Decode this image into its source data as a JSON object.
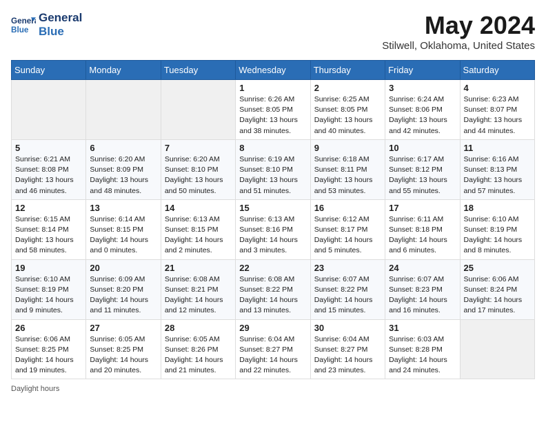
{
  "header": {
    "logo_line1": "General",
    "logo_line2": "Blue",
    "month_year": "May 2024",
    "location": "Stilwell, Oklahoma, United States"
  },
  "days_of_week": [
    "Sunday",
    "Monday",
    "Tuesday",
    "Wednesday",
    "Thursday",
    "Friday",
    "Saturday"
  ],
  "weeks": [
    [
      {
        "day": "",
        "sunrise": "",
        "sunset": "",
        "daylight": ""
      },
      {
        "day": "",
        "sunrise": "",
        "sunset": "",
        "daylight": ""
      },
      {
        "day": "",
        "sunrise": "",
        "sunset": "",
        "daylight": ""
      },
      {
        "day": "1",
        "sunrise": "6:26 AM",
        "sunset": "8:05 PM",
        "daylight": "13 hours and 38 minutes."
      },
      {
        "day": "2",
        "sunrise": "6:25 AM",
        "sunset": "8:05 PM",
        "daylight": "13 hours and 40 minutes."
      },
      {
        "day": "3",
        "sunrise": "6:24 AM",
        "sunset": "8:06 PM",
        "daylight": "13 hours and 42 minutes."
      },
      {
        "day": "4",
        "sunrise": "6:23 AM",
        "sunset": "8:07 PM",
        "daylight": "13 hours and 44 minutes."
      }
    ],
    [
      {
        "day": "5",
        "sunrise": "6:21 AM",
        "sunset": "8:08 PM",
        "daylight": "13 hours and 46 minutes."
      },
      {
        "day": "6",
        "sunrise": "6:20 AM",
        "sunset": "8:09 PM",
        "daylight": "13 hours and 48 minutes."
      },
      {
        "day": "7",
        "sunrise": "6:20 AM",
        "sunset": "8:10 PM",
        "daylight": "13 hours and 50 minutes."
      },
      {
        "day": "8",
        "sunrise": "6:19 AM",
        "sunset": "8:10 PM",
        "daylight": "13 hours and 51 minutes."
      },
      {
        "day": "9",
        "sunrise": "6:18 AM",
        "sunset": "8:11 PM",
        "daylight": "13 hours and 53 minutes."
      },
      {
        "day": "10",
        "sunrise": "6:17 AM",
        "sunset": "8:12 PM",
        "daylight": "13 hours and 55 minutes."
      },
      {
        "day": "11",
        "sunrise": "6:16 AM",
        "sunset": "8:13 PM",
        "daylight": "13 hours and 57 minutes."
      }
    ],
    [
      {
        "day": "12",
        "sunrise": "6:15 AM",
        "sunset": "8:14 PM",
        "daylight": "13 hours and 58 minutes."
      },
      {
        "day": "13",
        "sunrise": "6:14 AM",
        "sunset": "8:15 PM",
        "daylight": "14 hours and 0 minutes."
      },
      {
        "day": "14",
        "sunrise": "6:13 AM",
        "sunset": "8:15 PM",
        "daylight": "14 hours and 2 minutes."
      },
      {
        "day": "15",
        "sunrise": "6:13 AM",
        "sunset": "8:16 PM",
        "daylight": "14 hours and 3 minutes."
      },
      {
        "day": "16",
        "sunrise": "6:12 AM",
        "sunset": "8:17 PM",
        "daylight": "14 hours and 5 minutes."
      },
      {
        "day": "17",
        "sunrise": "6:11 AM",
        "sunset": "8:18 PM",
        "daylight": "14 hours and 6 minutes."
      },
      {
        "day": "18",
        "sunrise": "6:10 AM",
        "sunset": "8:19 PM",
        "daylight": "14 hours and 8 minutes."
      }
    ],
    [
      {
        "day": "19",
        "sunrise": "6:10 AM",
        "sunset": "8:19 PM",
        "daylight": "14 hours and 9 minutes."
      },
      {
        "day": "20",
        "sunrise": "6:09 AM",
        "sunset": "8:20 PM",
        "daylight": "14 hours and 11 minutes."
      },
      {
        "day": "21",
        "sunrise": "6:08 AM",
        "sunset": "8:21 PM",
        "daylight": "14 hours and 12 minutes."
      },
      {
        "day": "22",
        "sunrise": "6:08 AM",
        "sunset": "8:22 PM",
        "daylight": "14 hours and 13 minutes."
      },
      {
        "day": "23",
        "sunrise": "6:07 AM",
        "sunset": "8:22 PM",
        "daylight": "14 hours and 15 minutes."
      },
      {
        "day": "24",
        "sunrise": "6:07 AM",
        "sunset": "8:23 PM",
        "daylight": "14 hours and 16 minutes."
      },
      {
        "day": "25",
        "sunrise": "6:06 AM",
        "sunset": "8:24 PM",
        "daylight": "14 hours and 17 minutes."
      }
    ],
    [
      {
        "day": "26",
        "sunrise": "6:06 AM",
        "sunset": "8:25 PM",
        "daylight": "14 hours and 19 minutes."
      },
      {
        "day": "27",
        "sunrise": "6:05 AM",
        "sunset": "8:25 PM",
        "daylight": "14 hours and 20 minutes."
      },
      {
        "day": "28",
        "sunrise": "6:05 AM",
        "sunset": "8:26 PM",
        "daylight": "14 hours and 21 minutes."
      },
      {
        "day": "29",
        "sunrise": "6:04 AM",
        "sunset": "8:27 PM",
        "daylight": "14 hours and 22 minutes."
      },
      {
        "day": "30",
        "sunrise": "6:04 AM",
        "sunset": "8:27 PM",
        "daylight": "14 hours and 23 minutes."
      },
      {
        "day": "31",
        "sunrise": "6:03 AM",
        "sunset": "8:28 PM",
        "daylight": "14 hours and 24 minutes."
      },
      {
        "day": "",
        "sunrise": "",
        "sunset": "",
        "daylight": ""
      }
    ]
  ],
  "footer": {
    "daylight_label": "Daylight hours"
  }
}
